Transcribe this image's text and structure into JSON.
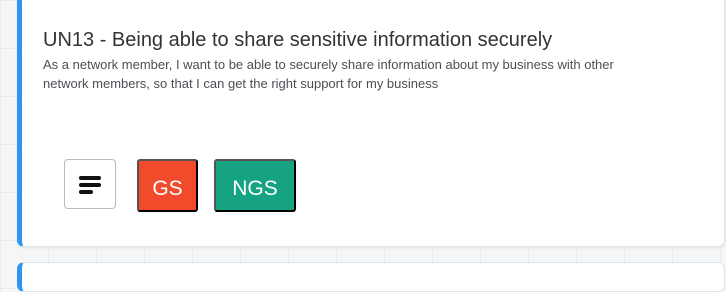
{
  "card": {
    "title": "UN13 - Being able to share sensitive information securely",
    "description": "As a network member, I want to be able to securely share information about my business with other network members, so that I can get the right support for my business",
    "accent_color": "#2f95ee"
  },
  "actions": {
    "menu_icon": "hamburger-menu-icon",
    "tags": [
      {
        "label": "GS",
        "color": "#f14b2c"
      },
      {
        "label": "NGS",
        "color": "#16a382"
      }
    ]
  }
}
